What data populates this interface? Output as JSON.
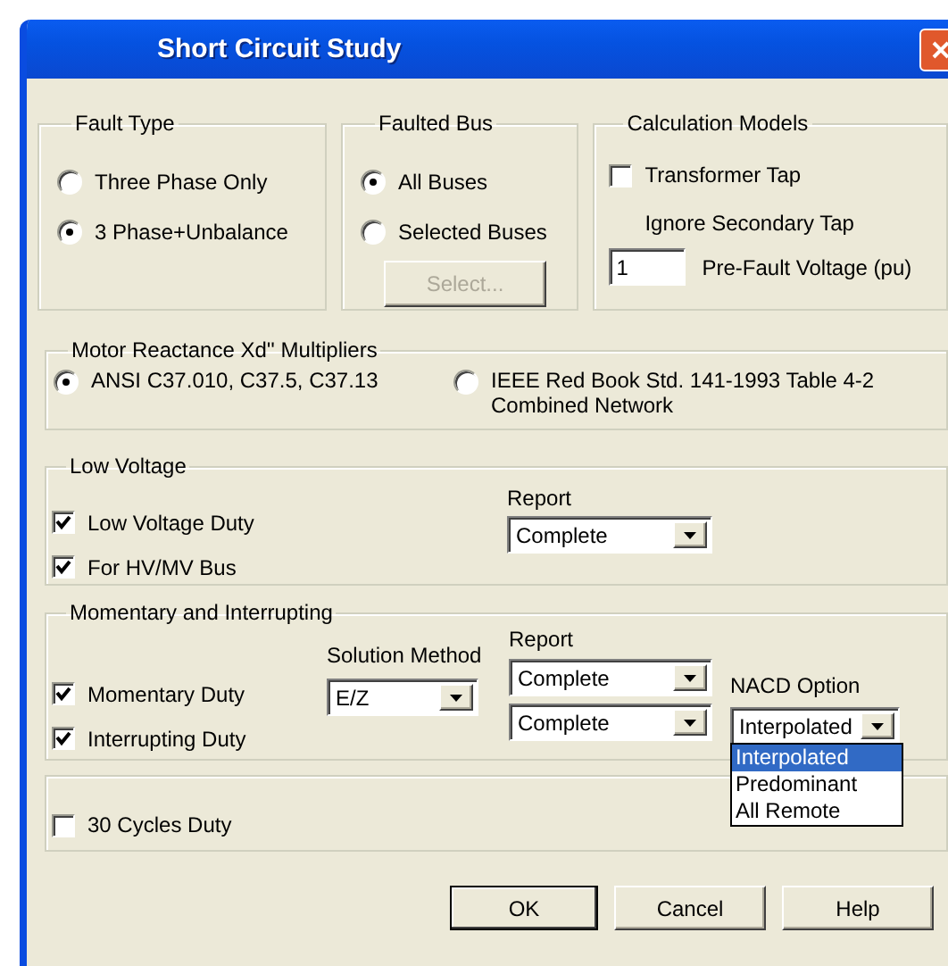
{
  "window": {
    "title": "Short Circuit Study"
  },
  "fault_type": {
    "label": "Fault Type",
    "options": [
      {
        "label": "Three Phase Only",
        "selected": false
      },
      {
        "label": "3 Phase+Unbalance",
        "selected": true
      }
    ]
  },
  "faulted_bus": {
    "label": "Faulted Bus",
    "options": [
      {
        "label": "All Buses",
        "selected": true
      },
      {
        "label": "Selected Buses",
        "selected": false
      }
    ],
    "select_button": {
      "label": "Select...",
      "disabled": true
    }
  },
  "calculation_models": {
    "label": "Calculation Models",
    "transformer_tap": {
      "label": "Transformer Tap",
      "checked": false
    },
    "note": "Ignore Secondary Tap",
    "prefault_voltage": {
      "value": "1",
      "label": "Pre-Fault Voltage (pu)"
    }
  },
  "motor_reactance": {
    "label": "Motor Reactance Xd'' Multipliers",
    "options": [
      {
        "label": "ANSI C37.010, C37.5, C37.13",
        "selected": true
      },
      {
        "label": "IEEE Red Book Std. 141-1993 Table 4-2",
        "sublabel": "Combined Network",
        "selected": false
      }
    ]
  },
  "low_voltage": {
    "label": "Low Voltage",
    "checks": [
      {
        "label": "Low Voltage Duty",
        "checked": true
      },
      {
        "label": "For HV/MV Bus",
        "checked": true
      }
    ],
    "report": {
      "label": "Report",
      "value": "Complete"
    }
  },
  "momentary_interrupting": {
    "label": "Momentary and Interrupting",
    "checks": [
      {
        "label": "Momentary Duty",
        "checked": true
      },
      {
        "label": "Interrupting Duty",
        "checked": true
      }
    ],
    "solution_method": {
      "label": "Solution Method",
      "value": "E/Z"
    },
    "report": {
      "label": "Report",
      "values": [
        "Complete",
        "Complete"
      ]
    },
    "nacd_option": {
      "label": "NACD Option",
      "value": "Interpolated",
      "expanded": true,
      "options": [
        {
          "label": "Interpolated",
          "selected": true
        },
        {
          "label": "Predominant",
          "selected": false
        },
        {
          "label": "All Remote",
          "selected": false
        }
      ]
    }
  },
  "cycles_30": {
    "checks": [
      {
        "label": "30 Cycles Duty",
        "checked": false
      }
    ]
  },
  "buttons": [
    {
      "label": "OK",
      "default": true
    },
    {
      "label": "Cancel",
      "default": false
    },
    {
      "label": "Help",
      "default": false
    }
  ]
}
